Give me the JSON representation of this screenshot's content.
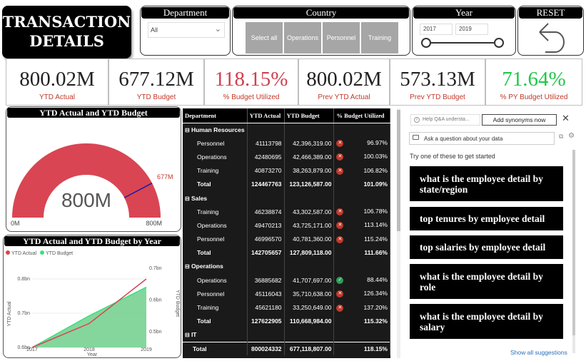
{
  "title": "TRANSACTION DETAILS",
  "slicers": {
    "department": {
      "label": "Department",
      "value": "All"
    },
    "country": {
      "label": "Country",
      "options": [
        "Select all",
        "Operations",
        "Personnel",
        "Training"
      ]
    },
    "year": {
      "label": "Year",
      "from": "2017",
      "to": "2019"
    },
    "reset": {
      "label": "RESET"
    }
  },
  "kpis": [
    {
      "value": "800.02M",
      "label": "YTD Actual",
      "value_color": "#222222"
    },
    {
      "value": "677.12M",
      "label": "YTD Budget",
      "value_color": "#222222"
    },
    {
      "value": "118.15%",
      "label": "% Budget Utilized",
      "value_color": "#d0404f"
    },
    {
      "value": "800.02M",
      "label": "Prev YTD Actual",
      "value_color": "#222222"
    },
    {
      "value": "573.13M",
      "label": "Prev YTD Budget",
      "value_color": "#222222"
    },
    {
      "value": "71.64%",
      "label": "% PY Budget Utilized",
      "value_color": "#1ec84a"
    }
  ],
  "gauge": {
    "title": "YTD Actual and YTD Budget",
    "value_label": "800M",
    "min_label": "0M",
    "max_label": "800M",
    "target_label": "677M",
    "value": 800,
    "min": 0,
    "max": 800,
    "target": 677,
    "color": "#d94553"
  },
  "chart_data": {
    "type": "area",
    "title": "YTD Actual and YTD Budget by Year",
    "x": [
      "2017",
      "2018",
      "2019"
    ],
    "series": [
      {
        "name": "YTD Actual",
        "values": [
          0.6,
          0.67,
          0.8
        ],
        "color": "#d94553"
      },
      {
        "name": "YTD Budget",
        "values": [
          0.45,
          0.55,
          0.64
        ],
        "color": "#3de07e"
      }
    ],
    "xlabel": "Year",
    "ylabel": "YTD Actual",
    "y2label": "YTD Budget",
    "y_ticks": [
      "0.6bn",
      "0.7bn",
      "0.8bn"
    ],
    "y2_ticks": [
      "0.5bn",
      "0.6bn",
      "0.7bn"
    ],
    "ylim": [
      0.6,
      0.85
    ],
    "y2lim": [
      0.45,
      0.72
    ],
    "legend": "top-left"
  },
  "matrix": {
    "headers": [
      "Department",
      "YTD Actual",
      "YTD Budget",
      "% Budget Utilized"
    ],
    "groups": [
      {
        "name": "Human Resources",
        "rows": [
          {
            "name": "Personnel",
            "actual": "41113798",
            "budget": "42,396,319.00",
            "status": "bad",
            "pct": "96.97%"
          },
          {
            "name": "Operations",
            "actual": "42480695",
            "budget": "42,466,389.00",
            "status": "bad",
            "pct": "100.03%"
          },
          {
            "name": "Training",
            "actual": "40873270",
            "budget": "38,263,879.00",
            "status": "bad",
            "pct": "106.82%"
          }
        ],
        "total": {
          "name": "Total",
          "actual": "124467763",
          "budget": "123,126,587.00",
          "pct": "101.09%"
        }
      },
      {
        "name": "Sales",
        "rows": [
          {
            "name": "Training",
            "actual": "46238874",
            "budget": "43,302,587.00",
            "status": "bad",
            "pct": "106.78%"
          },
          {
            "name": "Operations",
            "actual": "49470213",
            "budget": "43,725,171.00",
            "status": "bad",
            "pct": "113.14%"
          },
          {
            "name": "Personnel",
            "actual": "46996570",
            "budget": "40,781,360.00",
            "status": "bad",
            "pct": "115.24%"
          }
        ],
        "total": {
          "name": "Total",
          "actual": "142705657",
          "budget": "127,809,118.00",
          "pct": "111.66%"
        }
      },
      {
        "name": "Operations",
        "rows": [
          {
            "name": "Operations",
            "actual": "36885682",
            "budget": "41,707,697.00",
            "status": "good",
            "pct": "88.44%"
          },
          {
            "name": "Personnel",
            "actual": "45116043",
            "budget": "35,710,638.00",
            "status": "bad",
            "pct": "126.34%"
          },
          {
            "name": "Training",
            "actual": "45621180",
            "budget": "33,250,649.00",
            "status": "bad",
            "pct": "137.20%"
          }
        ],
        "total": {
          "name": "Total",
          "actual": "127622905",
          "budget": "110,668,984.00",
          "pct": "115.32%"
        }
      },
      {
        "name": "IT",
        "rows": [],
        "total": null
      }
    ],
    "grand_total": {
      "name": "Total",
      "actual": "800024332",
      "budget": "677,118,807.00",
      "pct": "118.15%"
    }
  },
  "qa": {
    "tip": "Help Q&A understa...",
    "add_synonyms": "Add synonyms now",
    "ask_placeholder": "Ask a question about your data",
    "try_text": "Try one of these to get started",
    "suggestions": [
      "what is the employee detail by state/region",
      "top tenures by employee detail",
      "top salaries by employee detail",
      "what is the employee detail by role",
      "what is the employee detail by salary"
    ],
    "show_all": "Show all suggestions"
  }
}
